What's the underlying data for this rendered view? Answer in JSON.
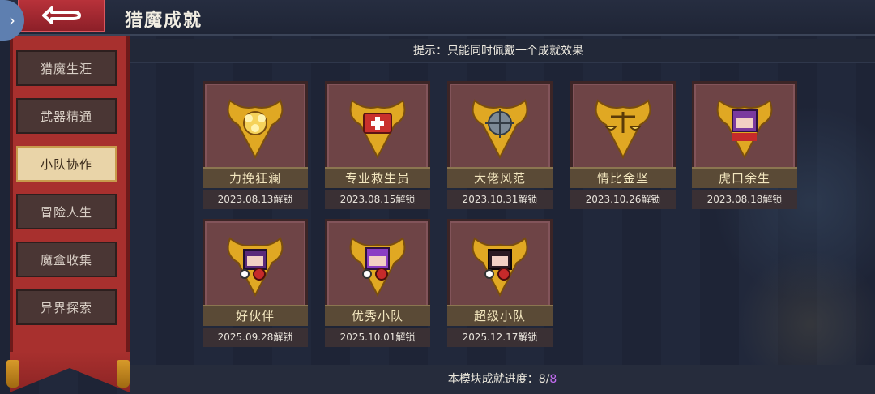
{
  "header": {
    "title": "猎魔成就",
    "hint": "提示：只能同时佩戴一个成就效果"
  },
  "sidebar": {
    "items": [
      {
        "label": "猎魔生涯",
        "active": false
      },
      {
        "label": "武器精通",
        "active": false
      },
      {
        "label": "小队协作",
        "active": true
      },
      {
        "label": "冒险人生",
        "active": false
      },
      {
        "label": "魔盒收集",
        "active": false
      },
      {
        "label": "异界探索",
        "active": false
      }
    ]
  },
  "achievements": [
    {
      "name": "力挽狂澜",
      "date": "2023.08.13解锁",
      "icon": "gold-emblem-icon"
    },
    {
      "name": "专业救生员",
      "date": "2023.08.15解锁",
      "icon": "medkit-emblem-icon"
    },
    {
      "name": "大佬风范",
      "date": "2023.10.31解锁",
      "icon": "steel-ball-emblem-icon"
    },
    {
      "name": "情比金坚",
      "date": "2023.10.26解锁",
      "icon": "balance-scale-emblem-icon"
    },
    {
      "name": "虎口余生",
      "date": "2023.08.18解锁",
      "icon": "purple-character-emblem-icon"
    },
    {
      "name": "好伙伴",
      "date": "2025.09.28解锁",
      "icon": "partner-character-emblem-icon"
    },
    {
      "name": "优秀小队",
      "date": "2025.10.01解锁",
      "icon": "team-character-emblem-icon"
    },
    {
      "name": "超级小队",
      "date": "2025.12.17解锁",
      "icon": "super-team-emblem-icon"
    }
  ],
  "footer": {
    "progress_label": "本模块成就进度：",
    "progress_current": "8",
    "progress_sep": "/",
    "progress_total": "8"
  },
  "colors": {
    "accent_purple": "#c26cf0",
    "banner_red": "#a8302e",
    "active_tab": "#e9d4a8"
  }
}
